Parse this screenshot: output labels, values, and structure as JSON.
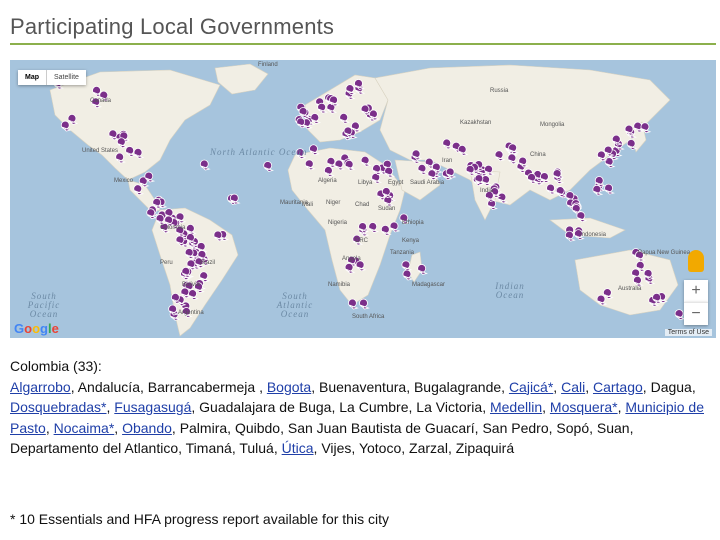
{
  "header": {
    "title": "Participating Local Governments"
  },
  "map": {
    "type_controls": {
      "map": "Map",
      "satellite": "Satellite"
    },
    "zoom_in": "+",
    "zoom_out": "−",
    "logo": "Google",
    "terms": "Terms of Use",
    "oceans": {
      "north_atlantic": "North Atlantic Ocean",
      "south_pacific": "South Pacific Ocean",
      "south_atlantic": "South Atlantic Ocean",
      "indian": "Indian Ocean"
    },
    "countries": [
      "Finland",
      "Canada",
      "United States",
      "Russia",
      "Kazakhstan",
      "China",
      "Algeria",
      "Libya",
      "Egypt",
      "Niger",
      "Chad",
      "Sudan",
      "Colombia",
      "Brazil",
      "Peru",
      "Angola",
      "Namibia",
      "Madagascar",
      "Saudi Arabia",
      "Iran",
      "Mongolia",
      "India",
      "Indonesia",
      "Papua New Guinea",
      "Australia",
      "Mexico",
      "Bolivia",
      "Argentina",
      "South Africa",
      "Ethiopia",
      "Kenya",
      "Nigeria",
      "Mali",
      "Mauritania",
      "DRC",
      "Tanzania"
    ],
    "colors": {
      "ocean": "#a6c4dd",
      "land": "#f1eee4",
      "marker": "#7b2f8a"
    }
  },
  "content": {
    "country": "Colombia",
    "count": "(33):",
    "cities": [
      {
        "name": "Algarrobo",
        "link": true
      },
      {
        "name": "Andalucía",
        "link": false
      },
      {
        "name": "Barrancabermeja ",
        "link": false
      },
      {
        "name": "Bogota",
        "link": true
      },
      {
        "name": "Buenaventura",
        "link": false
      },
      {
        "name": "Bugalagrande",
        "link": false
      },
      {
        "name": "Cajicá*",
        "link": true
      },
      {
        "name": "Cali",
        "link": true
      },
      {
        "name": "Cartago",
        "link": true
      },
      {
        "name": "Dagua",
        "link": false
      },
      {
        "name": "Dosquebradas*",
        "link": true
      },
      {
        "name": "Fusagasugá",
        "link": true
      },
      {
        "name": "Guadalajara de Buga",
        "link": false
      },
      {
        "name": "La Cumbre",
        "link": false
      },
      {
        "name": "La Victoria",
        "link": false
      },
      {
        "name": "Medellin",
        "link": true
      },
      {
        "name": "Mosquera*",
        "link": true
      },
      {
        "name": "Municipio de Pasto",
        "link": true
      },
      {
        "name": "Nocaima*",
        "link": true
      },
      {
        "name": "Obando",
        "link": true
      },
      {
        "name": "Palmira",
        "link": false
      },
      {
        "name": "Quibdo",
        "link": false
      },
      {
        "name": "San Juan Bautista de Guacarí",
        "link": false
      },
      {
        "name": "San Pedro",
        "link": false
      },
      {
        "name": "Sopó",
        "link": false
      },
      {
        "name": "Suan",
        "link": false
      },
      {
        "name": "Departamento del Atlantico",
        "link": false
      },
      {
        "name": "Timaná",
        "link": false
      },
      {
        "name": "Tuluá",
        "link": false
      },
      {
        "name": "Útica",
        "link": true
      },
      {
        "name": "Vijes",
        "link": false
      },
      {
        "name": "Yotoco",
        "link": false
      },
      {
        "name": "Zarzal",
        "link": false
      },
      {
        "name": "Zipaquirá",
        "link": false
      }
    ],
    "footnote": "* 10 Essentials and HFA progress report available for this city"
  }
}
